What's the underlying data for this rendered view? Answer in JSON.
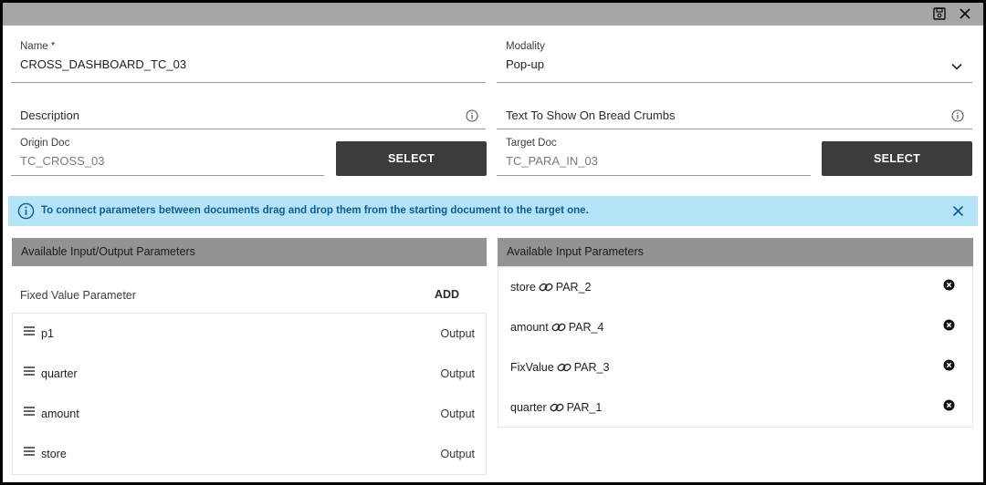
{
  "window": {
    "save_icon": "save-icon",
    "close_icon": "close-icon"
  },
  "form": {
    "name": {
      "label": "Name *",
      "value": "CROSS_DASHBOARD_TC_03"
    },
    "modality": {
      "label": "Modality",
      "value": "Pop-up"
    },
    "description": {
      "placeholder": "Description"
    },
    "breadcrumbs": {
      "placeholder": "Text To Show On Bread Crumbs"
    },
    "origin_doc": {
      "label": "Origin Doc",
      "value": "TC_CROSS_03",
      "button": "SELECT"
    },
    "target_doc": {
      "label": "Target Doc",
      "value": "TC_PARA_IN_03",
      "button": "SELECT"
    }
  },
  "banner": {
    "text": "To connect parameters between documents drag and drop them from the starting document to the target one.",
    "color": "#b5e4f6"
  },
  "left_panel": {
    "title": "Available Input/Output Parameters",
    "fixed_value_label": "Fixed Value Parameter",
    "add_label": "ADD",
    "params": [
      {
        "name": "p1",
        "direction": "Output"
      },
      {
        "name": "quarter",
        "direction": "Output"
      },
      {
        "name": "amount",
        "direction": "Output"
      },
      {
        "name": "store",
        "direction": "Output"
      }
    ]
  },
  "right_panel": {
    "title": "Available Input Parameters",
    "links": [
      {
        "source": "store",
        "target": "PAR_2"
      },
      {
        "source": "amount",
        "target": "PAR_4"
      },
      {
        "source": "FixValue",
        "target": "PAR_3"
      },
      {
        "source": "quarter",
        "target": "PAR_1"
      }
    ]
  }
}
